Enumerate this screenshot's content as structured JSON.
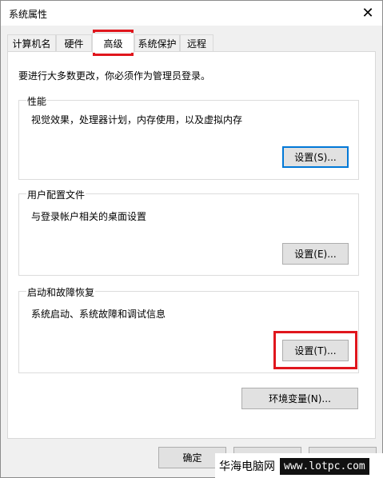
{
  "window": {
    "title": "系统属性",
    "close": "✕"
  },
  "tabs": [
    {
      "label": "计算机名"
    },
    {
      "label": "硬件"
    },
    {
      "label": "高级"
    },
    {
      "label": "系统保护"
    },
    {
      "label": "远程"
    }
  ],
  "active_tab": "高级",
  "intro": "要进行大多数更改，你必须作为管理员登录。",
  "performance": {
    "legend": "性能",
    "desc": "视觉效果，处理器计划，内存使用，以及虚拟内存",
    "button": "设置(S)..."
  },
  "user_profiles": {
    "legend": "用户配置文件",
    "desc": "与登录帐户相关的桌面设置",
    "button": "设置(E)..."
  },
  "startup_recovery": {
    "legend": "启动和故障恢复",
    "desc": "系统启动、系统故障和调试信息",
    "button": "设置(T)..."
  },
  "env_button": "环境变量(N)...",
  "footer": {
    "ok": "确定"
  },
  "watermark": {
    "cn": "华海电脑网",
    "url": "www.lotpc.com"
  },
  "colors": {
    "highlight": "#e0161d",
    "accent": "#0078d7"
  }
}
